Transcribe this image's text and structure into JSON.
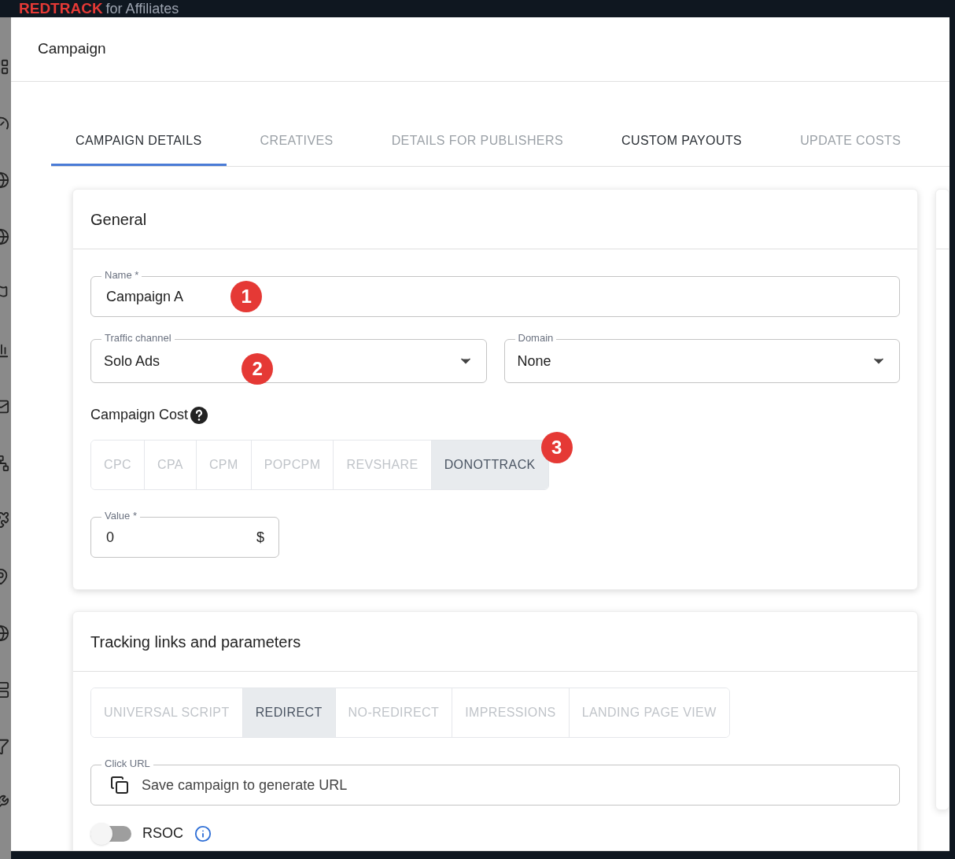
{
  "app_bar": {
    "logo_brand": "REDTRACK",
    "logo_suffix": "for Affiliates"
  },
  "dialog": {
    "title": "Campaign"
  },
  "tabs": [
    {
      "label": "CAMPAIGN DETAILS",
      "selected": true,
      "disabled": false
    },
    {
      "label": "CREATIVES",
      "selected": false,
      "disabled": true
    },
    {
      "label": "DETAILS FOR PUBLISHERS",
      "selected": false,
      "disabled": true
    },
    {
      "label": "CUSTOM PAYOUTS",
      "selected": false,
      "disabled": false
    },
    {
      "label": "UPDATE COSTS",
      "selected": false,
      "disabled": true
    }
  ],
  "general": {
    "title": "General",
    "name": {
      "label": "Name *",
      "value": "Campaign A",
      "marker": "1"
    },
    "traffic_channel": {
      "label": "Traffic channel",
      "value": "Solo Ads",
      "marker": "2"
    },
    "domain": {
      "label": "Domain",
      "value": "None"
    },
    "cost_title": "Campaign Cost",
    "cost_types": [
      {
        "label": "CPC",
        "selected": false
      },
      {
        "label": "CPA",
        "selected": false
      },
      {
        "label": "CPM",
        "selected": false
      },
      {
        "label": "POPCPM",
        "selected": false
      },
      {
        "label": "REVSHARE",
        "selected": false
      },
      {
        "label": "DONOTTRACK",
        "selected": true
      }
    ],
    "cost_marker": "3",
    "value": {
      "label": "Value *",
      "value": "0",
      "unit": "$"
    }
  },
  "tracking": {
    "title": "Tracking links and parameters",
    "link_types": [
      {
        "label": "UNIVERSAL SCRIPT",
        "selected": false
      },
      {
        "label": "REDIRECT",
        "selected": true
      },
      {
        "label": "NO-REDIRECT",
        "selected": false
      },
      {
        "label": "IMPRESSIONS",
        "selected": false
      },
      {
        "label": "LANDING PAGE VIEW",
        "selected": false
      }
    ],
    "click_url": {
      "label": "Click URL",
      "value": "Save campaign to generate URL"
    },
    "rsoc": {
      "label": "RSOC",
      "on": false
    }
  }
}
